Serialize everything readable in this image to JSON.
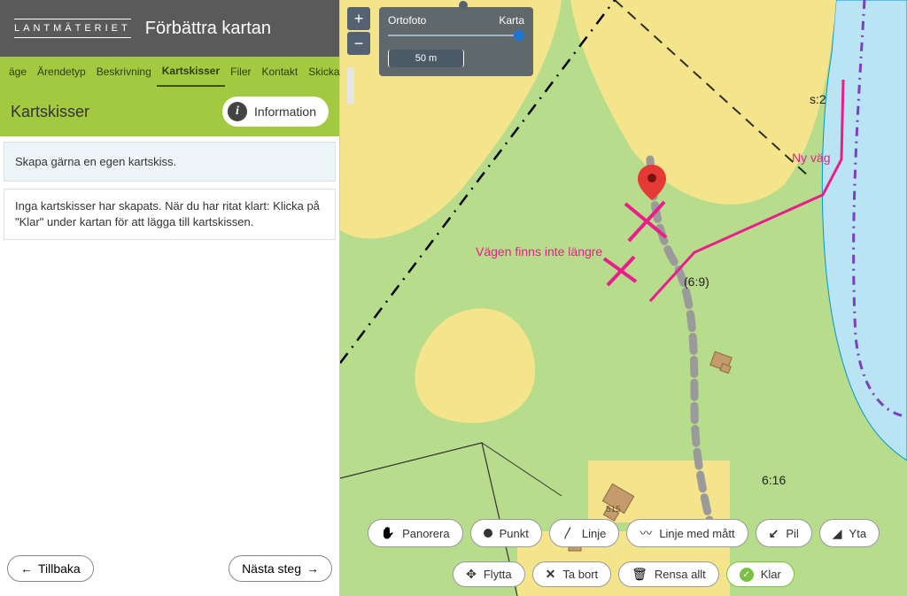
{
  "header": {
    "logo": "LANTMÄTERIET",
    "title": "Förbättra kartan"
  },
  "tabs": [
    "äge",
    "Ärendetyp",
    "Beskrivning",
    "Kartskisser",
    "Filer",
    "Kontakt",
    "Skicka in"
  ],
  "active_tab_index": 3,
  "section": {
    "title": "Kartskisser",
    "info_button": "Information",
    "hint": "Skapa gärna en egen kartskiss.",
    "empty_msg": "Inga kartskisser har skapats. När du har ritat klart: Klicka på \"Klar\" under kartan för att lägga till kartskissen."
  },
  "footer": {
    "back": "Tillbaka",
    "next": "Nästa steg"
  },
  "map_controls": {
    "layer_left": "Ortofoto",
    "layer_right": "Karta",
    "scale": "50 m"
  },
  "map_labels": {
    "parcel_1": "s:2",
    "parcel_2": "(6:9)",
    "parcel_3": "6:16",
    "house_num": "515",
    "annot_1": "Vägen finns inte längre",
    "annot_2": "Ny väg"
  },
  "tools": {
    "pan": "Panorera",
    "point": "Punkt",
    "line": "Linje",
    "line_measure": "Linje med mått",
    "arrow": "Pil",
    "area": "Yta",
    "move": "Flytta",
    "delete": "Ta bort",
    "clear": "Rensa allt",
    "done": "Klar"
  }
}
